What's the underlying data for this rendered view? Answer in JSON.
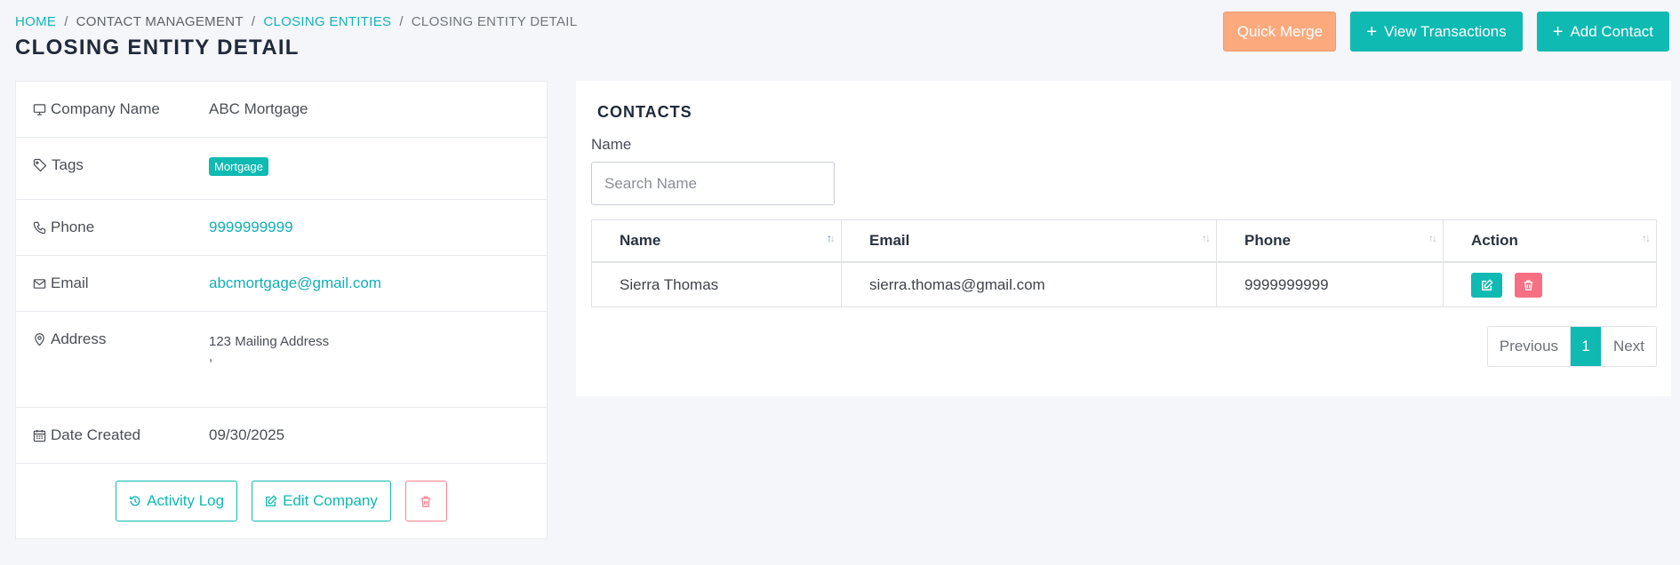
{
  "breadcrumb": {
    "home": "HOME",
    "contact_management": "CONTACT MANAGEMENT",
    "closing_entities": "CLOSING ENTITIES",
    "current": "CLOSING ENTITY DETAIL",
    "separator": "/"
  },
  "page_title": "CLOSING ENTITY DETAIL",
  "top_actions": {
    "quick_merge": "Quick Merge",
    "view_transactions": "View Transactions",
    "add_contact": "Add Contact"
  },
  "details": {
    "company_name": {
      "label": "Company Name",
      "value": "ABC Mortgage"
    },
    "tags": {
      "label": "Tags",
      "value": "Mortgage"
    },
    "phone": {
      "label": "Phone",
      "value": "9999999999"
    },
    "email": {
      "label": "Email",
      "value": "abcmortgage@gmail.com"
    },
    "address": {
      "label": "Address",
      "line1": "123 Mailing Address",
      "line2": ","
    },
    "date_created": {
      "label": "Date Created",
      "value": "09/30/2025"
    }
  },
  "card_actions": {
    "activity_log": "Activity Log",
    "edit_company": "Edit Company"
  },
  "contacts": {
    "title": "CONTACTS",
    "name_label": "Name",
    "search_placeholder": "Search Name",
    "columns": [
      "Name",
      "Email",
      "Phone",
      "Action"
    ],
    "rows": [
      {
        "name": "Sierra Thomas",
        "email": "sierra.thomas@gmail.com",
        "phone": "9999999999"
      }
    ],
    "pagination": {
      "previous": "Previous",
      "page": "1",
      "next": "Next"
    }
  },
  "colors": {
    "accent": "#0ebab2",
    "orange": "#fca97e",
    "danger": "#f66f82",
    "background": "#f4f6f9"
  }
}
